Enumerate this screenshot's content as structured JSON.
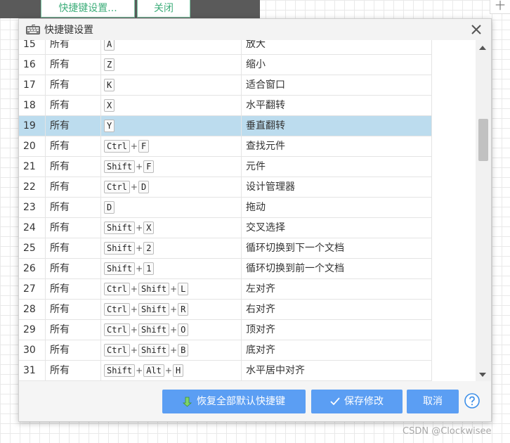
{
  "top_tabs": {
    "tab1": "快捷键设置...",
    "tab2": "关闭"
  },
  "corner": "十",
  "dialog": {
    "title": "快捷键设置",
    "rows": [
      {
        "num": "15",
        "scope": "所有",
        "keys": [
          "A"
        ],
        "desc": "放大"
      },
      {
        "num": "16",
        "scope": "所有",
        "keys": [
          "Z"
        ],
        "desc": "缩小"
      },
      {
        "num": "17",
        "scope": "所有",
        "keys": [
          "K"
        ],
        "desc": "适合窗口"
      },
      {
        "num": "18",
        "scope": "所有",
        "keys": [
          "X"
        ],
        "desc": "水平翻转"
      },
      {
        "num": "19",
        "scope": "所有",
        "keys": [
          "Y"
        ],
        "desc": "垂直翻转",
        "selected": true
      },
      {
        "num": "20",
        "scope": "所有",
        "keys": [
          "Ctrl",
          "F"
        ],
        "desc": "查找元件"
      },
      {
        "num": "21",
        "scope": "所有",
        "keys": [
          "Shift",
          "F"
        ],
        "desc": "元件"
      },
      {
        "num": "22",
        "scope": "所有",
        "keys": [
          "Ctrl",
          "D"
        ],
        "desc": "设计管理器"
      },
      {
        "num": "23",
        "scope": "所有",
        "keys": [
          "D"
        ],
        "desc": "拖动"
      },
      {
        "num": "24",
        "scope": "所有",
        "keys": [
          "Shift",
          "X"
        ],
        "desc": "交叉选择"
      },
      {
        "num": "25",
        "scope": "所有",
        "keys": [
          "Shift",
          "2"
        ],
        "desc": "循环切换到下一个文档"
      },
      {
        "num": "26",
        "scope": "所有",
        "keys": [
          "Shift",
          "1"
        ],
        "desc": "循环切换到前一个文档"
      },
      {
        "num": "27",
        "scope": "所有",
        "keys": [
          "Ctrl",
          "Shift",
          "L"
        ],
        "desc": "左对齐"
      },
      {
        "num": "28",
        "scope": "所有",
        "keys": [
          "Ctrl",
          "Shift",
          "R"
        ],
        "desc": "右对齐"
      },
      {
        "num": "29",
        "scope": "所有",
        "keys": [
          "Ctrl",
          "Shift",
          "O"
        ],
        "desc": "顶对齐"
      },
      {
        "num": "30",
        "scope": "所有",
        "keys": [
          "Ctrl",
          "Shift",
          "B"
        ],
        "desc": "底对齐"
      },
      {
        "num": "31",
        "scope": "所有",
        "keys": [
          "Shift",
          "Alt",
          "H"
        ],
        "desc": "水平居中对齐"
      },
      {
        "num": "",
        "scope": "",
        "keys": [
          "Shift",
          "Alt"
        ],
        "desc": ""
      }
    ],
    "buttons": {
      "restore": "恢复全部默认快捷键",
      "save": "保存修改",
      "cancel": "取消"
    }
  },
  "watermark": "CSDN @Clockwisee",
  "colors": {
    "accent_button": "#5b9ef3",
    "selected_row": "#bcdcee",
    "tab_green": "#3fae7b"
  }
}
